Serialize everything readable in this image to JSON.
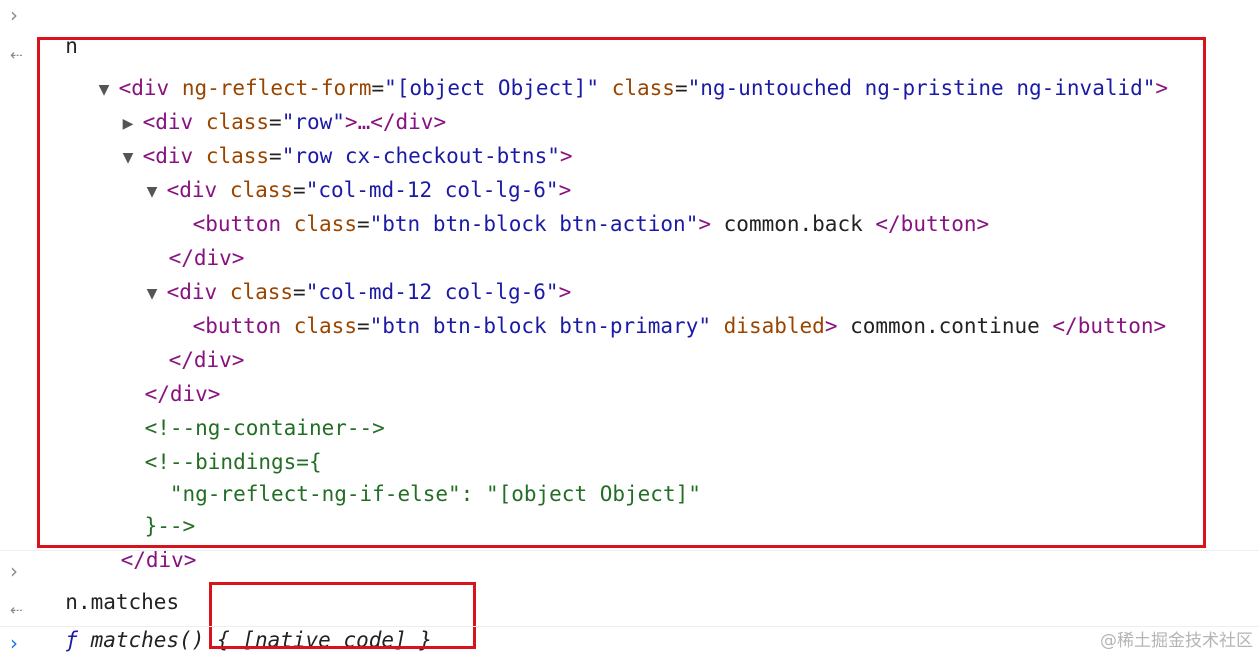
{
  "console": {
    "entry1": {
      "input": "n",
      "result_lines": {
        "l1": {
          "open": "<",
          "tag": "div",
          "a1": "ng-reflect-form",
          "eq": "=",
          "v1": "\"[object Object]\"",
          "a2": "class",
          "v2": "\"ng-untouched ng-pristine ng-invalid\"",
          "close": ">"
        },
        "l2": {
          "open": "<",
          "tag": "div",
          "a1": "class",
          "eq": "=",
          "v1": "\"row\"",
          "mid": ">…</",
          "tag2": "div",
          "close": ">"
        },
        "l3": {
          "open": "<",
          "tag": "div",
          "a1": "class",
          "eq": "=",
          "v1": "\"row cx-checkout-btns\"",
          "close": ">"
        },
        "l4": {
          "open": "<",
          "tag": "div",
          "a1": "class",
          "eq": "=",
          "v1": "\"col-md-12 col-lg-6\"",
          "close": ">"
        },
        "l5": {
          "open": "<",
          "tag": "button",
          "a1": "class",
          "eq": "=",
          "v1": "\"btn btn-block btn-action\"",
          "close": ">",
          "text": " common.back ",
          "endtag": "</button>"
        },
        "l6": {
          "endtag": "</div>"
        },
        "l7": {
          "open": "<",
          "tag": "div",
          "a1": "class",
          "eq": "=",
          "v1": "\"col-md-12 col-lg-6\"",
          "close": ">"
        },
        "l8": {
          "open": "<",
          "tag": "button",
          "a1": "class",
          "eq": "=",
          "v1": "\"btn btn-block btn-primary\"",
          "a2": "disabled",
          "close": ">",
          "text": " common.continue ",
          "endtag": "</button>"
        },
        "l9": {
          "endtag": "</div>"
        },
        "l10": {
          "endtag": "</div>"
        },
        "l11": {
          "comment": "<!--ng-container-->"
        },
        "l12": {
          "comment": "<!--bindings={"
        },
        "l13": {
          "comment": "  \"ng-reflect-ng-if-else\": \"[object Object]\""
        },
        "l14": {
          "comment": "}-->"
        },
        "l15": {
          "endtag": "</div>"
        }
      }
    },
    "entry2": {
      "input": "n.matches",
      "result": {
        "f": "ƒ",
        "name": " matches() { ",
        "body": "[native code]",
        "end": " }"
      }
    }
  },
  "icons": {
    "prompt": "›",
    "result": "⇠",
    "expanded": "▼",
    "collapsed": "▶"
  },
  "colors": {
    "tag": "#881280",
    "attribute": "#994500",
    "value": "#1a1aa6",
    "comment": "#236e25",
    "highlight": "#d9121b",
    "prompt_active": "#1a73e8"
  },
  "watermark": "@稀土掘金技术社区"
}
